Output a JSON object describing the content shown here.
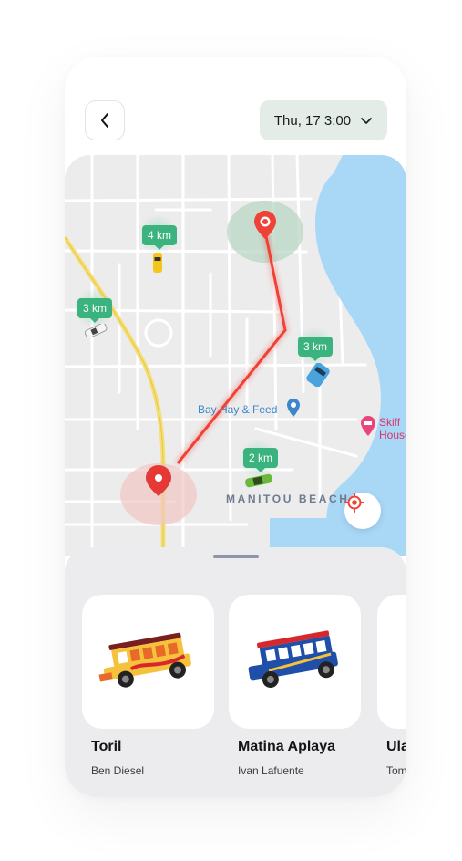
{
  "header": {
    "back_icon": "chevron-left-icon",
    "date_label": "Thu, 17 3:00",
    "dropdown_icon": "chevron-down-icon"
  },
  "map": {
    "distance_badges": [
      "4 km",
      "3 km",
      "3 km",
      "2 km"
    ],
    "poi_labels": {
      "bay_hay": "Bay Hay & Feed",
      "skiff": "Skiff",
      "skiff_line2": "House",
      "area": "MANITOU BEACH"
    },
    "colors": {
      "route": "#ef4136",
      "badge": "#3bb37e",
      "water": "#a9d8f7",
      "highway": "#f5df7a"
    },
    "locate_icon": "crosshair-target-icon"
  },
  "routes": [
    {
      "title": "Toril",
      "driver": "Ben Diesel",
      "vehicle": "jeepney-yellow"
    },
    {
      "title": "Matina Aplaya",
      "driver": "Ivan Lafuente",
      "vehicle": "jeepney-blue"
    },
    {
      "title": "Ulas",
      "driver": "Tom",
      "vehicle": "jeepney"
    }
  ]
}
